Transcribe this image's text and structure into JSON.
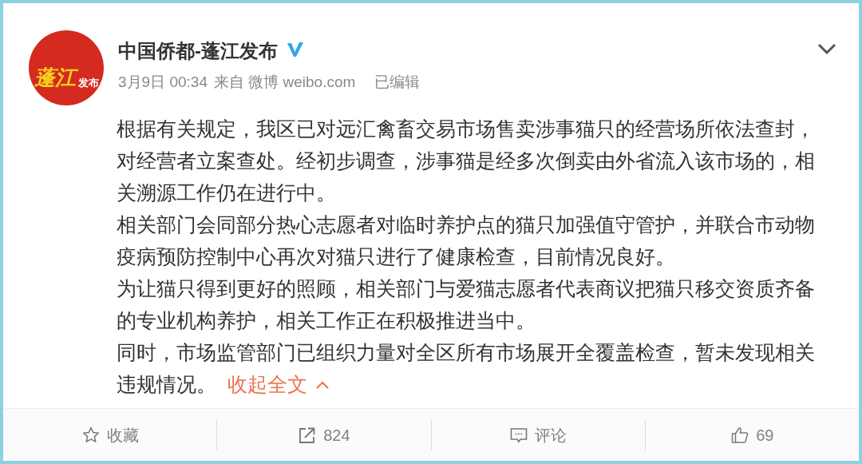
{
  "post": {
    "avatar": {
      "text_main": "蓬江",
      "text_sub": "发布"
    },
    "author": "中国侨都-蓬江发布",
    "verified": true,
    "date": "3月9日 00:34",
    "source": "来自 微博 weibo.com",
    "edited": "已编辑",
    "paragraphs": [
      "根据有关规定，我区已对远汇禽畜交易市场售卖涉事猫只的经营场所依法查封，对经营者立案查处。经初步调查，涉事猫是经多次倒卖由外省流入该市场的，相关溯源工作仍在进行中。",
      "相关部门会同部分热心志愿者对临时养护点的猫只加强值守管护，并联合市动物疫病预防控制中心再次对猫只进行了健康检查，目前情况良好。",
      "为让猫只得到更好的照顾，相关部门与爱猫志愿者代表商议把猫只移交资质齐备的专业机构养护，相关工作正在积极推进当中。",
      "同时，市场监管部门已组织力量对全区所有市场展开全覆盖检查，暂未发现相关违规情况。"
    ],
    "collapse_link": "收起全文"
  },
  "actions": [
    {
      "kind": "favorite",
      "label": "收藏"
    },
    {
      "kind": "repost",
      "label": "824"
    },
    {
      "kind": "comment",
      "label": "评论"
    },
    {
      "kind": "like",
      "label": "69"
    }
  ]
}
